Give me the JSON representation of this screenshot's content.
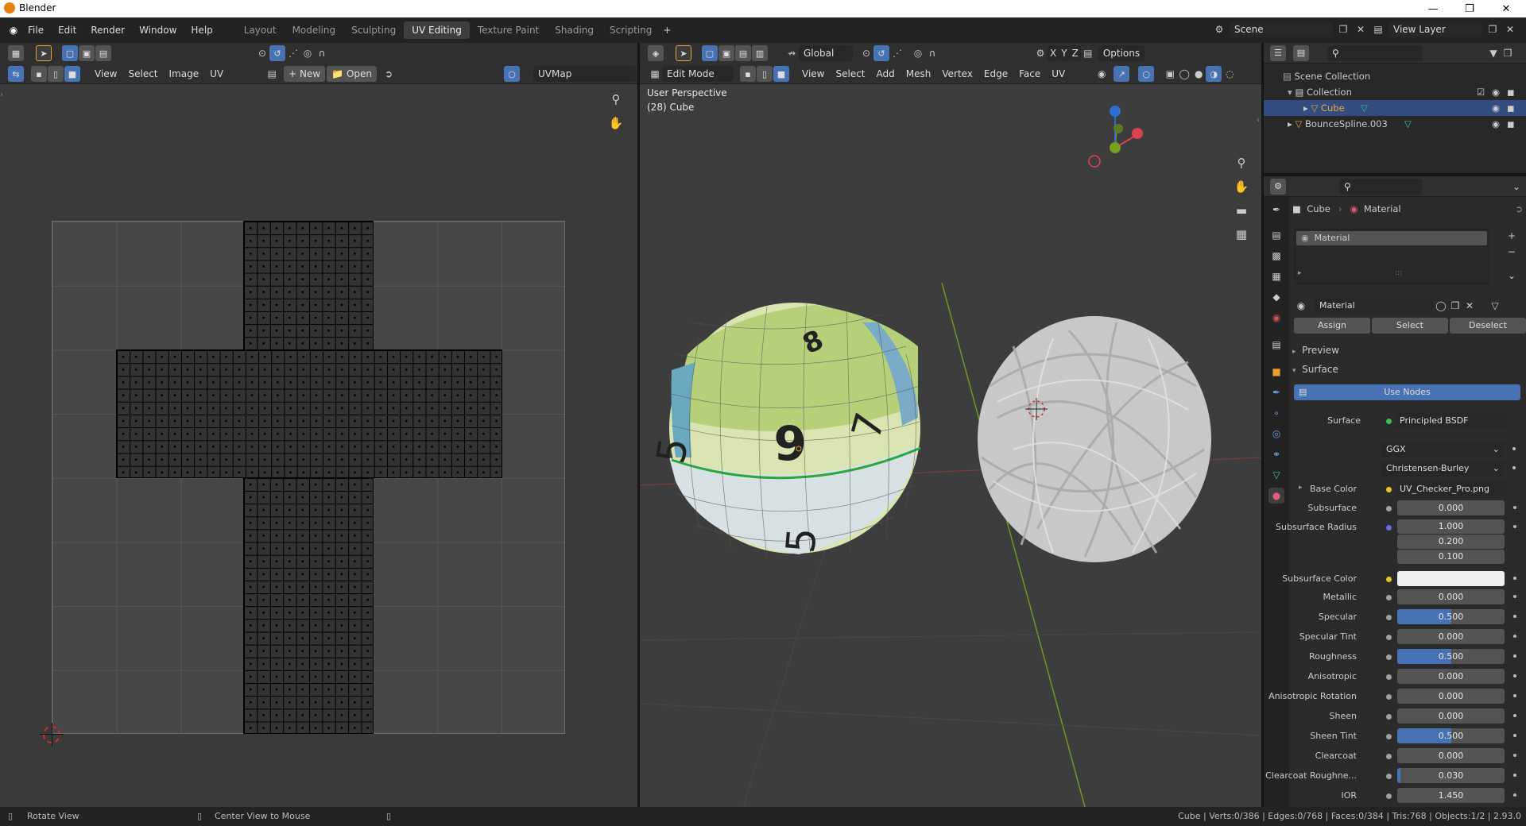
{
  "app": {
    "title": "Blender"
  },
  "menu": [
    "File",
    "Edit",
    "Render",
    "Window",
    "Help"
  ],
  "workspaces": [
    "Layout",
    "Modeling",
    "Sculpting",
    "UV Editing",
    "Texture Paint",
    "Shading",
    "Scripting"
  ],
  "scene": {
    "name": "Scene",
    "view_layer": "View Layer"
  },
  "uv_editor": {
    "menus": [
      "View",
      "Select",
      "Image",
      "UV"
    ],
    "new_label": "New",
    "open_label": "Open",
    "uvmap": "UVMap"
  },
  "viewport": {
    "mode": "Edit Mode",
    "orientation": "Global",
    "options_label": "Options",
    "menus": [
      "View",
      "Add",
      "Mesh",
      "Vertex",
      "Edge",
      "Face",
      "UV"
    ],
    "select_label": "Select",
    "axes": [
      "X",
      "Y",
      "Z"
    ],
    "overlay_title": "User Perspective",
    "overlay_sub": "(28) Cube",
    "dice_numbers": [
      "8",
      "5",
      "6",
      "7",
      "5"
    ]
  },
  "outliner": {
    "root": "Scene Collection",
    "collection": "Collection",
    "items": [
      "Cube",
      "BounceSpline.003"
    ]
  },
  "properties": {
    "breadcrumb_object": "Cube",
    "breadcrumb_material": "Material",
    "slot": "Material",
    "material_name": "Material",
    "assign": "Assign",
    "select": "Select",
    "deselect": "Deselect",
    "panel_preview": "Preview",
    "panel_surface": "Surface",
    "use_nodes": "Use Nodes",
    "surface_label": "Surface",
    "surface_value": "Principled BSDF",
    "distribution": "GGX",
    "subsurface_method": "Christensen-Burley",
    "base_color_label": "Base Color",
    "base_color_value": "UV_Checker_Pro.png",
    "subsurface_radius_label": "Subsurface Radius",
    "subsurface_radius": [
      "1.000",
      "0.200",
      "0.100"
    ],
    "subsurface_color_label": "Subsurface Color",
    "fields": [
      {
        "label": "Subsurface",
        "value": "0.000",
        "fill": 0
      },
      {
        "label": "Metallic",
        "value": "0.000",
        "fill": 0
      },
      {
        "label": "Specular",
        "value": "0.500",
        "fill": 0.5
      },
      {
        "label": "Specular Tint",
        "value": "0.000",
        "fill": 0
      },
      {
        "label": "Roughness",
        "value": "0.500",
        "fill": 0.5
      },
      {
        "label": "Anisotropic",
        "value": "0.000",
        "fill": 0
      },
      {
        "label": "Anisotropic Rotation",
        "value": "0.000",
        "fill": 0
      },
      {
        "label": "Sheen",
        "value": "0.000",
        "fill": 0
      },
      {
        "label": "Sheen Tint",
        "value": "0.500",
        "fill": 0.5
      },
      {
        "label": "Clearcoat",
        "value": "0.000",
        "fill": 0
      },
      {
        "label": "Clearcoat Roughne...",
        "value": "0.030",
        "fill": 0.03
      },
      {
        "label": "IOR",
        "value": "1.450",
        "fill": 0
      }
    ]
  },
  "status": {
    "rotate": "Rotate View",
    "center": "Center View to Mouse",
    "stats": "Cube | Verts:0/386 | Edges:0/768 | Faces:0/384 | Tris:768 | Objects:1/2 | 2.93.0"
  },
  "colors": {
    "accent": "#4772b3",
    "header": "#303030",
    "editor_bg": "#2b2b2b",
    "uv_bg": "#3a3a3a",
    "viewport_bg": "#3d3d3d"
  }
}
